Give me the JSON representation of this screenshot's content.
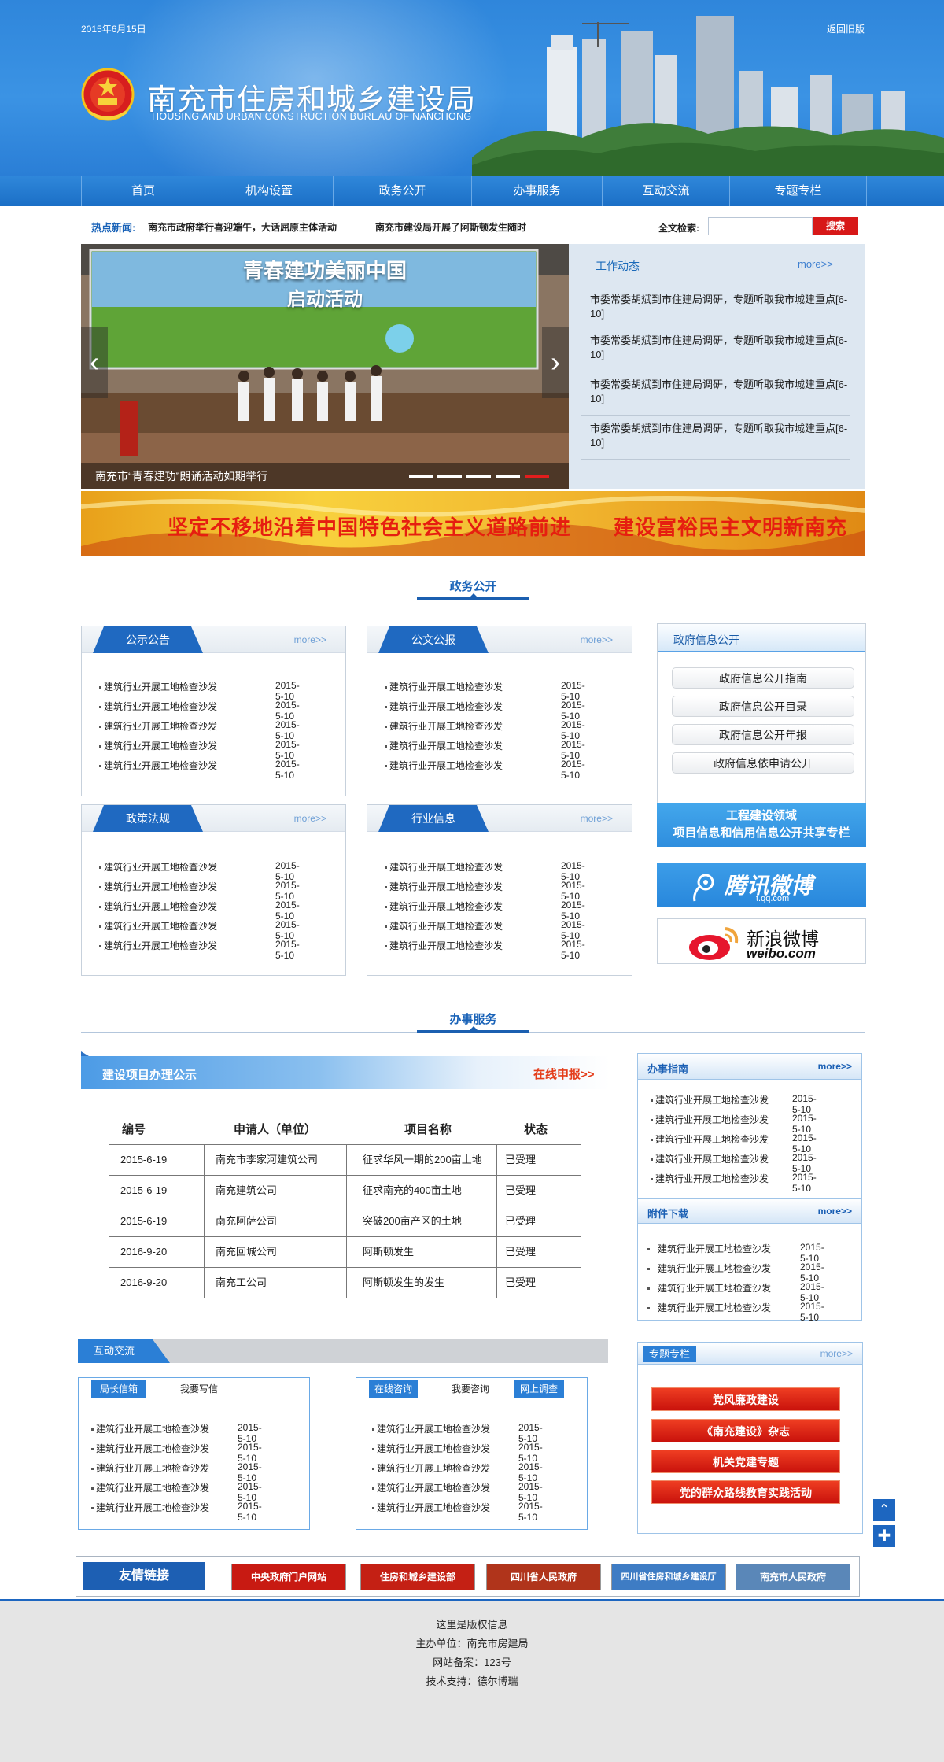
{
  "header": {
    "date": "2015年6月15日",
    "old_version": "返回旧版",
    "title": "南充市住房和城乡建设局",
    "subtitle": "HOUSING AND URBAN CONSTRUCTION BUREAU OF NANCHONG",
    "brand_color": "#2f86db"
  },
  "nav": {
    "items": [
      "首页",
      "机构设置",
      "政务公开",
      "办事服务",
      "互动交流",
      "专题专栏"
    ]
  },
  "hot": {
    "label": "热点新闻:",
    "news1": "南充市政府举行喜迎端午，大话屈原主体活动",
    "news2": "南充市建设局开展了阿斯顿发生随时",
    "search_label": "全文检索:",
    "search_placeholder": "",
    "search_button": "搜索"
  },
  "slide": {
    "caption": "南充市“青春建功”朗诵活动如期举行",
    "screen_title1": "青春建功美丽中国",
    "screen_title2": "启动活动",
    "active_dot": 5
  },
  "work": {
    "title": "工作动态",
    "more": "more>>",
    "items": [
      "市委常委胡斌到市住建局调研，专题听取我市城建重点[6-10]",
      "市委常委胡斌到市住建局调研，专题听取我市城建重点[6-10]",
      "市委常委胡斌到市住建局调研，专题听取我市城建重点[6-10]",
      "市委常委胡斌到市住建局调研，专题听取我市城建重点[6-10]"
    ]
  },
  "banner": {
    "text": "坚定不移地沿着中国特色社会主义道路前进　　建设富裕民主文明新南充"
  },
  "sections": {
    "gov": "政务公开",
    "service": "办事服务"
  },
  "boxes": [
    {
      "title": "公示公告",
      "more": "more>>"
    },
    {
      "title": "公文公报",
      "more": "more>>"
    },
    {
      "title": "政策法规",
      "more": "more>>"
    },
    {
      "title": "行业信息",
      "more": "more>>"
    }
  ],
  "list_item": {
    "text": "建筑行业开展工地检查沙发",
    "date": "2015-5-10"
  },
  "govinfo": {
    "title": "政府信息公开",
    "buttons": [
      "政府信息公开指南",
      "政府信息公开目录",
      "政府信息公开年报",
      "政府信息依申请公开"
    ]
  },
  "project_btn": {
    "line1": "工程建设领域",
    "line2": "项目信息和信用信息公开共享专栏"
  },
  "tencent": {
    "name": "腾讯微博",
    "url": "t.qq.com"
  },
  "weibo": {
    "name": "新浪微博",
    "url": "weibo.com"
  },
  "service": {
    "title": "建设项目办理公示",
    "online": "在线申报>>",
    "headers": [
      "编号",
      "申请人（单位）",
      "项目名称",
      "状态"
    ],
    "rows": [
      [
        "2015-6-19",
        "南充市李家河建筑公司",
        "征求华风一期的200亩土地",
        "已受理"
      ],
      [
        "2015-6-19",
        "南充建筑公司",
        "征求南充的400亩土地",
        "已受理"
      ],
      [
        "2015-6-19",
        "南充阿萨公司",
        "突破200亩产区的土地",
        "已受理"
      ],
      [
        "2016-9-20",
        "南充回城公司",
        "阿斯顿发生",
        "已受理"
      ],
      [
        "2016-9-20",
        "南充工公司",
        "阿斯顿发生的发生",
        "已受理"
      ]
    ]
  },
  "guide": {
    "title": "办事指南",
    "more": "more>>"
  },
  "download": {
    "title": "附件下载",
    "more": "more>>"
  },
  "interact": {
    "title": "互动交流",
    "box1_tabs": [
      "局长信箱",
      "我要写信"
    ],
    "box2_tabs": [
      "在线咨询",
      "我要咨询",
      "网上调查"
    ]
  },
  "topics": {
    "title": "专题专栏",
    "more": "more>>",
    "items": [
      "党风廉政建设",
      "《南充建设》杂志",
      "机关党建专题",
      "党的群众路线教育实践活动"
    ]
  },
  "links": {
    "label": "友情链接",
    "items": [
      "中央政府门户网站",
      "住房和城乡建设部",
      "四川省人民政府",
      "四川省住房和城乡建设厅",
      "南充市人民政府"
    ]
  },
  "footer": {
    "copyright": "这里是版权信息",
    "host": "主办单位：南充市房建局",
    "record": "网站备案：123号",
    "support": "技术支持：德尔博瑞"
  }
}
